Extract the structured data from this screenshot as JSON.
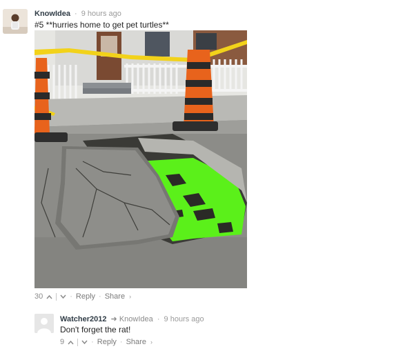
{
  "comment": {
    "author": "KnowIdea",
    "time": "9 hours ago",
    "separator": "·",
    "text": "#5 **hurries home to get pet turtles**",
    "photo_icon": "sinkhole-photo",
    "votes": "30",
    "upvote_icon": "chevron-up",
    "downvote_icon": "chevron-down",
    "reply_label": "Reply",
    "share_label": "Share",
    "share_chevron": "›"
  },
  "reply": {
    "author": "Watcher2012",
    "reply_arrow_icon": "reply-arrow",
    "reply_arrow": "➜",
    "reply_to": "KnowIdea",
    "time": "9 hours ago",
    "separator": "·",
    "text": "Don't forget the rat!",
    "votes": "9",
    "reply_label": "Reply",
    "share_label": "Share",
    "share_chevron": "›"
  },
  "colors": {
    "author": "#2f3b45",
    "meta": "#9a9a9a",
    "slime": "#5bf01a",
    "cone_orange": "#e8631c",
    "tape_yellow": "#f2d21a"
  }
}
